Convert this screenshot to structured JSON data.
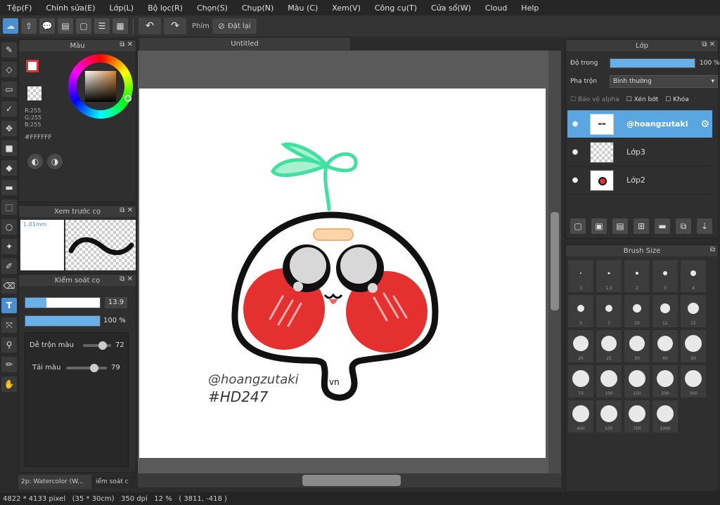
{
  "menu": [
    "Tệp(F)",
    "Chỉnh sửa(E)",
    "Lớp(L)",
    "Bộ lọc(R)",
    "Chọn(S)",
    "Chụp(N)",
    "Màu (C)",
    "Xem(V)",
    "Công cụ(T)",
    "Cửa sổ(W)",
    "Cloud",
    "Help"
  ],
  "toolbar": {
    "phim_label": "Phím",
    "reset_label": "Đặt lại"
  },
  "canvas": {
    "tab_title": "Untitled"
  },
  "artwork": {
    "line1": "@hoangzutaki",
    "line2": "#HD247",
    "mouth_text": "vn"
  },
  "color_panel": {
    "title": "Màu",
    "r": "R:255",
    "g": "G:255",
    "b": "B:255",
    "hex": "#FFFFFF"
  },
  "preview_panel": {
    "title": "Xem trước cọ",
    "size": "1.01mm"
  },
  "brush_control": {
    "title": "Kiểm soát cọ",
    "size_value": "13.9",
    "opacity_value": "100 %",
    "blend_label": "Dễ trộn màu",
    "blend_value": "72",
    "color_label": "Tải màu",
    "color_value": "79"
  },
  "brush_tabs": {
    "tab1": "2p: Watercolor (W...",
    "tab2": "iểm soát c"
  },
  "layers_panel": {
    "title": "Lớp",
    "opacity_label": "Độ trong",
    "opacity_value": "100 %",
    "blend_label": "Pha trộn",
    "blend_value": "Bình thường",
    "protect_alpha": "Bảo vệ alpha",
    "clip": "Xén bớt",
    "lock": "Khóa",
    "layers": [
      {
        "name": "@hoangzutaki"
      },
      {
        "name": "Lớp3"
      },
      {
        "name": "Lớp2"
      }
    ]
  },
  "brush_size_panel": {
    "title": "Brush Size",
    "sizes": [
      "1",
      "1.5",
      "2",
      "3",
      "4",
      "5",
      "7",
      "10",
      "12",
      "15",
      "20",
      "25",
      "30",
      "40",
      "50",
      "70",
      "100",
      "150",
      "200",
      "300",
      "400",
      "500",
      "700",
      "1000"
    ]
  },
  "status": {
    "text": "4822 * 4133 pixel   (35 * 30cm)   350 dpi   12 %   ( 3811, -418 )"
  },
  "colors": {
    "accent": "#5aa6e0",
    "cheek": "#e53030",
    "sprout": "#3fe0a0",
    "bg": "#2b2b2b"
  }
}
